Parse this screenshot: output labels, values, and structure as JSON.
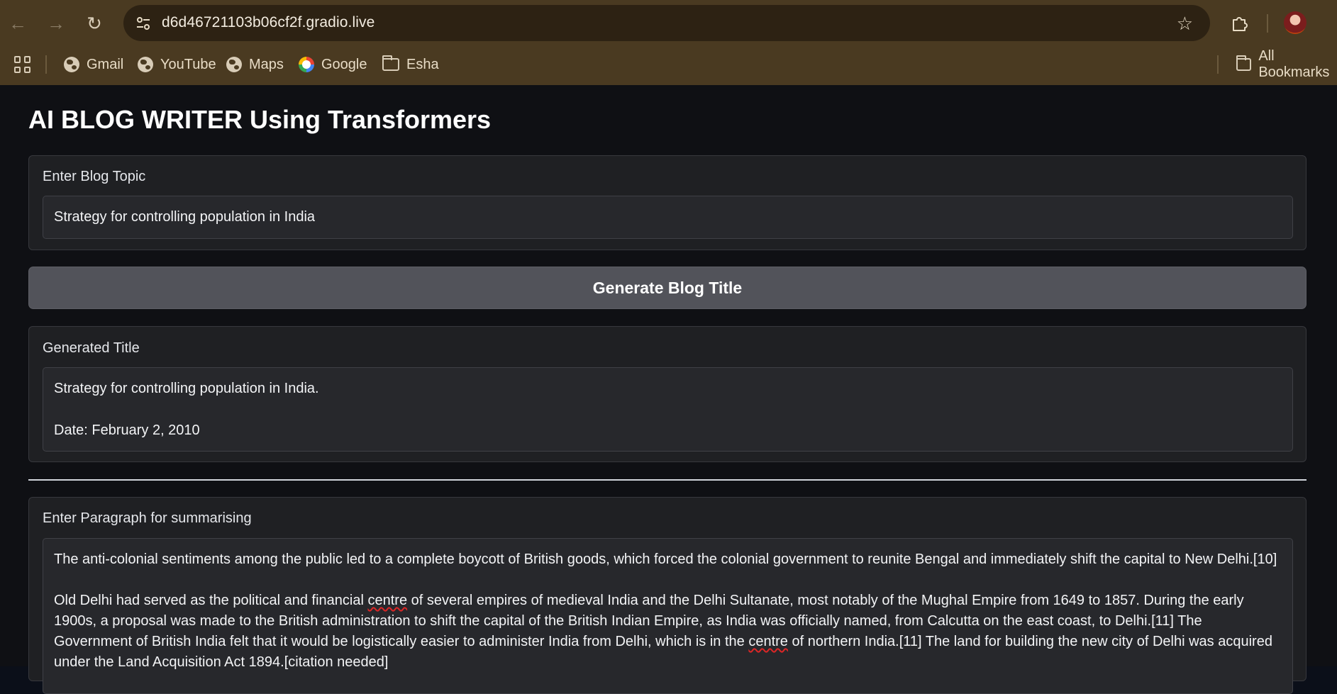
{
  "browser": {
    "url": "d6d46721103b06cf2f.gradio.live",
    "bookmarks": [
      "Gmail",
      "YouTube",
      "Maps",
      "Google",
      "Esha"
    ],
    "all_bookmarks": "All Bookmarks"
  },
  "app": {
    "title": "AI BLOG WRITER Using Transformers",
    "topic_label": "Enter Blog Topic",
    "topic_value": "Strategy for controlling population in India",
    "generate_button": "Generate Blog Title",
    "generated_label": "Generated Title",
    "generated_line1": "Strategy for controlling population in India.",
    "generated_line2": "Date: February 2, 2010",
    "paragraph_label": "Enter Paragraph for summarising",
    "paragraph_1": "The anti-colonial sentiments among the public led to a complete boycott of British goods, which forced the colonial government to reunite Bengal and immediately shift the capital to New Delhi.[10]",
    "paragraph_2_a": "Old Delhi had served as the political and financial ",
    "paragraph_2_b": "centre",
    "paragraph_2_c": " of several empires of medieval India and the Delhi Sultanate, most notably of the Mughal Empire from 1649 to 1857. During the early 1900s, a proposal was made to the British administration to shift the capital of the British Indian Empire, as India was officially named, from Calcutta on the east coast, to Delhi.[11] The Government of British India felt that it would be logistically easier to administer India from Delhi, which is in the ",
    "paragraph_2_d": "centre",
    "paragraph_2_e": " of northern India.[11] The land for building the new city of Delhi was acquired under the Land Acquisition Act 1894.[citation needed]"
  }
}
